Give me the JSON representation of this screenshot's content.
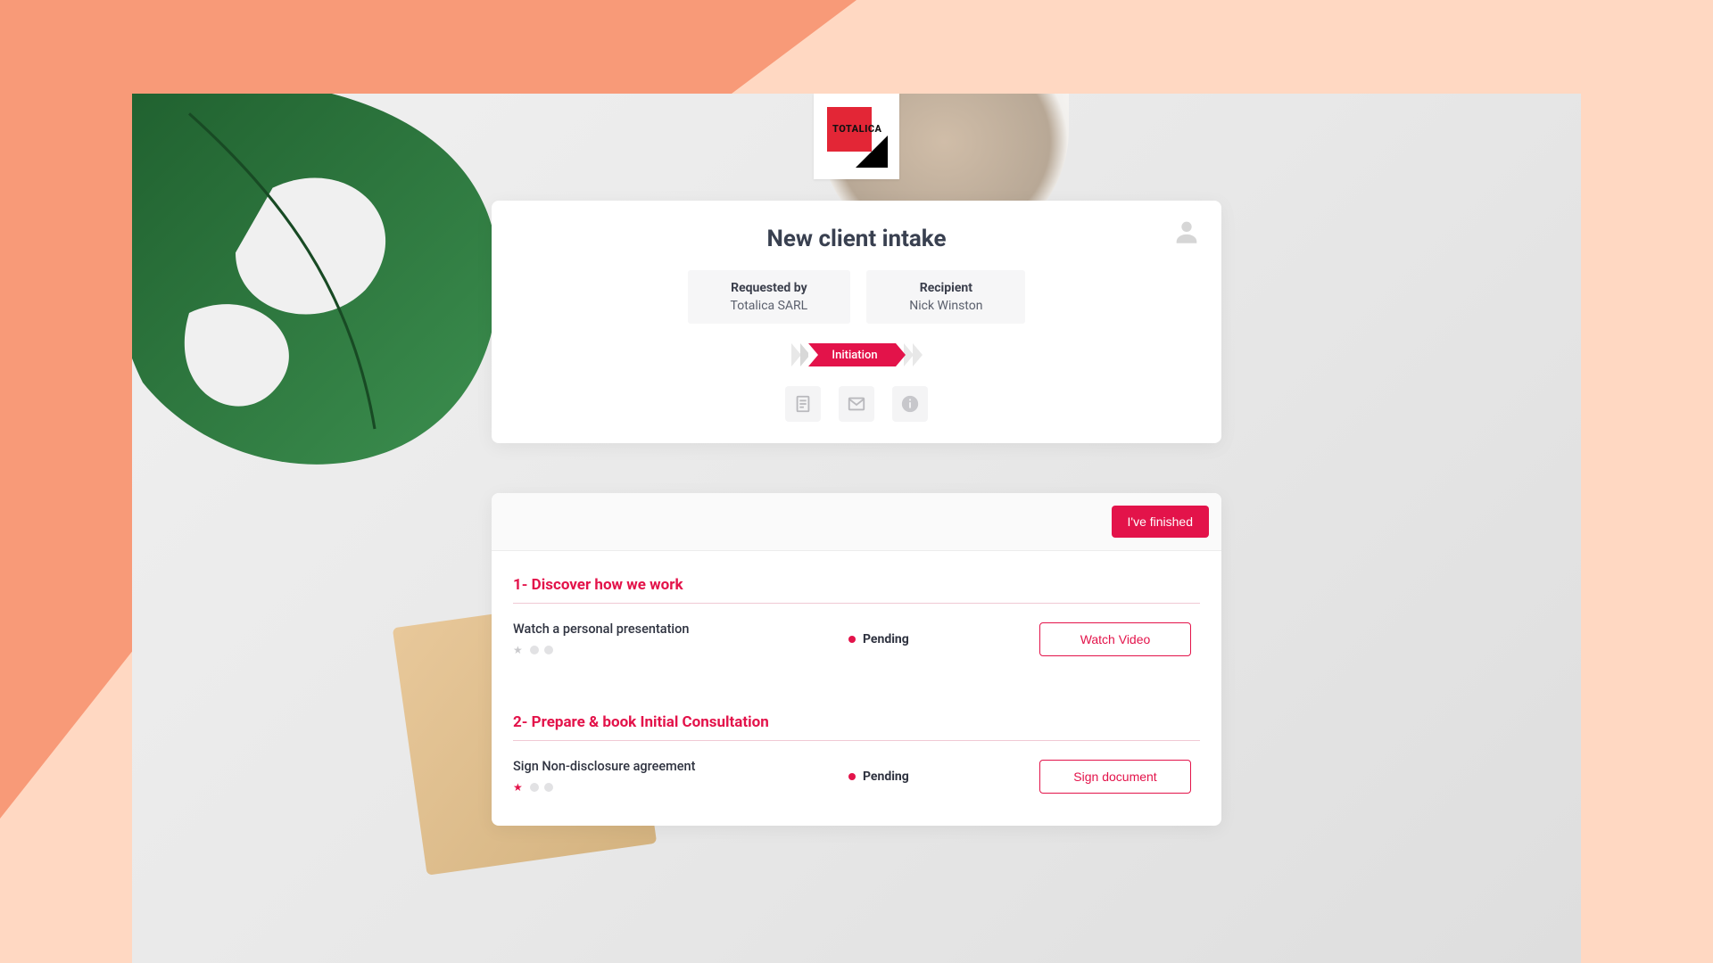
{
  "brand": {
    "name": "TOTALICA"
  },
  "colors": {
    "accent": "#e3134a"
  },
  "header": {
    "title": "New client intake",
    "requested_by_label": "Requested by",
    "requested_by_value": "Totalica SARL",
    "recipient_label": "Recipient",
    "recipient_value": "Nick Winston",
    "active_step": "Initiation"
  },
  "icon_buttons": {
    "notes": "notes-icon",
    "email": "email-icon",
    "info": "info-icon"
  },
  "actions": {
    "finished": "I've finished"
  },
  "sections": [
    {
      "title": "1- Discover how we work",
      "tasks": [
        {
          "name": "Watch a personal presentation",
          "status": "Pending",
          "starred": false,
          "action_label": "Watch Video"
        }
      ]
    },
    {
      "title": "2- Prepare & book Initial Consultation",
      "tasks": [
        {
          "name": "Sign Non-disclosure agreement",
          "status": "Pending",
          "starred": true,
          "action_label": "Sign document"
        }
      ]
    }
  ]
}
